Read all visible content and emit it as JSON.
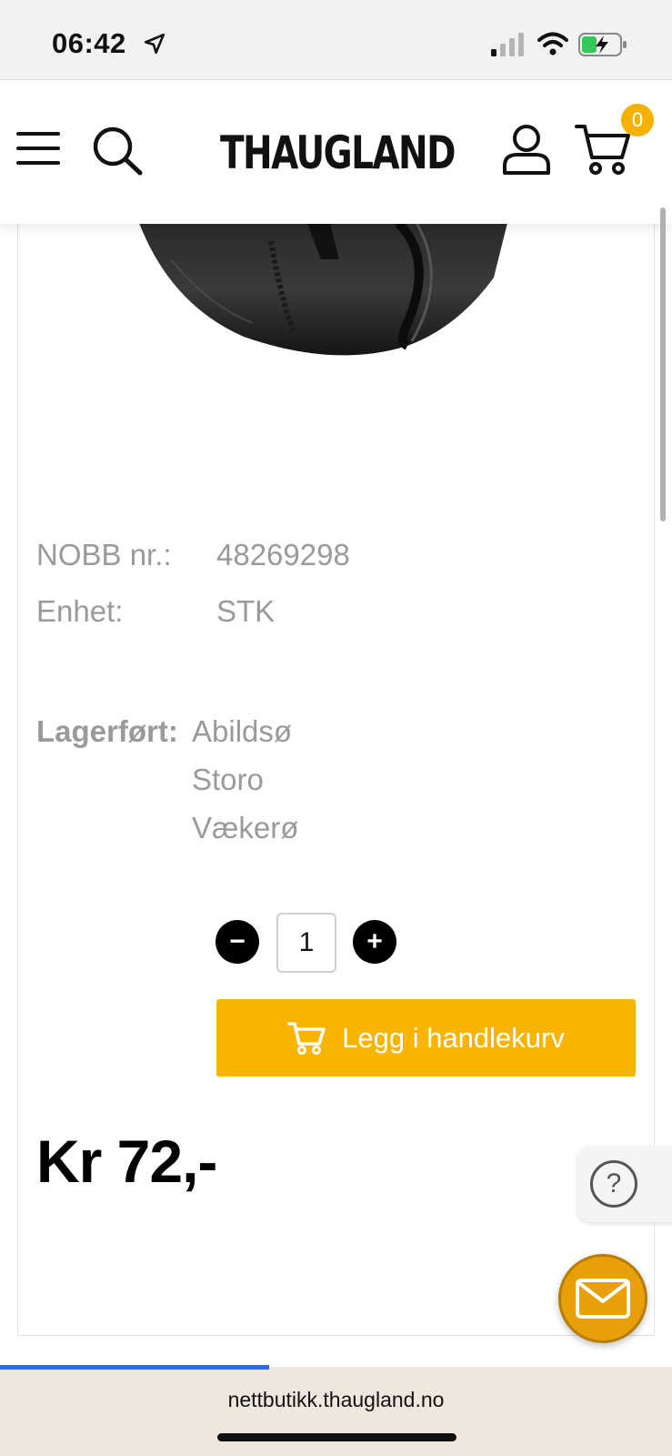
{
  "status_bar": {
    "time": "06:42",
    "icons": [
      "location-arrow-icon",
      "cellular-signal-icon",
      "wifi-icon",
      "battery-charging-icon"
    ]
  },
  "header": {
    "brand": "THAUGLAND",
    "cart_count": "0",
    "accent_color": "#f5b100"
  },
  "product": {
    "specs": [
      {
        "label": "NOBB nr.:",
        "value": "48269298"
      },
      {
        "label": "Enhet:",
        "value": "STK"
      }
    ],
    "stock_label": "Lagerført:",
    "stock_locations": [
      "Abildsø",
      "Storo",
      "Vækerø"
    ],
    "quantity": "1",
    "minus_label": "−",
    "plus_label": "+",
    "add_to_cart_label": "Legg i handlekurv",
    "price": "Kr 72,-"
  },
  "help": {
    "label": "?"
  },
  "browser": {
    "url": "nettbutikk.thaugland.no",
    "load_progress": 0.4
  }
}
